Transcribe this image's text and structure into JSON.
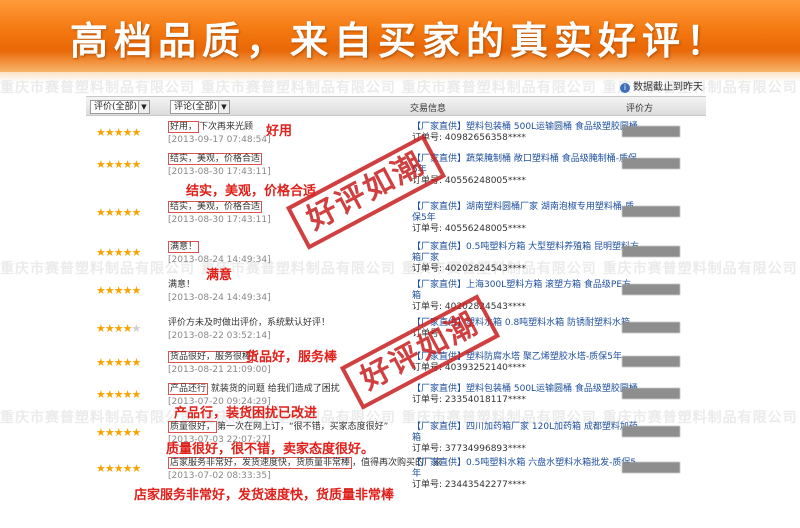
{
  "banner": {
    "text": "高档品质，来自买家的真实好评！"
  },
  "watermark": {
    "text": "重庆市赛普塑料制品有限公司 重庆市赛普塑料制品有限公司 重庆市赛普塑料制品有限公司 重庆市赛普塑料制品有限公司"
  },
  "updated": {
    "text": "数据截止到昨天"
  },
  "header": {
    "rating_select": "评价(全部)",
    "comment_select": "评论(全部)",
    "trade_label": "交易信息",
    "rater_label": "评价方"
  },
  "colors": {
    "accent": "#f47a12",
    "highlight": "#d9534f",
    "annotation": "#e0201a",
    "link": "#1d4f9c",
    "star": "#f6a400"
  },
  "stamps": [
    {
      "text": "好评如潮"
    },
    {
      "text": "好评如潮"
    }
  ],
  "reviews": [
    {
      "stars": "★★★★★",
      "dim": "",
      "comment": "好用，下次再来光顾",
      "hl": "好用，",
      "date": "[2013-09-17 07:48:54]",
      "annotation": "好用",
      "trade_title": "【厂家直供】塑料包装桶 500L运输圆桶 食品级塑胶圆桶",
      "order": "订单号: 40982656358****"
    },
    {
      "stars": "★★★★★",
      "dim": "",
      "comment": "结实，美观，价格合适",
      "hl": "结实，美观，价格合适",
      "date": "[2013-08-30 17:43:11]",
      "annotation": "结实，美观，价格合适",
      "trade_title": "【厂家直供】蔬菜腌制桶 敞口塑料桶 食品级腌制桶-质保5年",
      "order": "订单号: 40556248005****"
    },
    {
      "stars": "★★★★★",
      "dim": "",
      "comment": "结实，美观，价格合适",
      "hl": "结实，美观，价格合适",
      "date": "[2013-08-30 17:43:11]",
      "annotation": "",
      "trade_title": "【厂家直供】湖南塑料圆桶厂家 湖南泡椒专用塑料桶-质保5年",
      "order": "订单号: 40556248005****"
    },
    {
      "stars": "★★★★★",
      "dim": "",
      "comment": "满意！",
      "hl": "满意！",
      "date": "[2013-08-24 14:49:34]",
      "annotation": "满意",
      "trade_title": "【厂家直供】0.5吨塑料方箱 大型塑料养殖箱 昆明塑料方箱厂家",
      "order": "订单号: 40202824543****"
    },
    {
      "stars": "★★★★★",
      "dim": "",
      "comment": "满意！",
      "hl": "",
      "date": "[2013-08-24 14:49:34]",
      "annotation": "",
      "trade_title": "【厂家直供】上海300L塑料方箱 滚塑方箱 食品级PE方箱",
      "order": "订单号: 40202824543****"
    },
    {
      "stars": "★★★★",
      "dim": "★",
      "comment": "评价方未及时做出评价，系统默认好评！",
      "hl": "",
      "date": "[2013-08-22 03:52:14]",
      "annotation": "",
      "trade_title": "【厂家直供】塑料水箱 0.8吨塑料水箱 防锈耐塑料水箱",
      "order": "订单号:"
    },
    {
      "stars": "★★★★★",
      "dim": "",
      "comment": "货品很好，服务很棒",
      "hl": "货品很好，服务很棒",
      "date": "[2013-08-21 21:09:00]",
      "annotation": "货品好，服务棒",
      "trade_title": "【厂家直供】塑料防腐水塔 聚乙烯塑胶水塔-质保5年",
      "order": "订单号: 40393252140****"
    },
    {
      "stars": "★★★★★",
      "dim": "",
      "comment": "产品还行 就装货的问题 给我们造成了困扰",
      "hl": "产品还行",
      "date": "[2013-07-20 09:24:29]",
      "annotation": "产品行，装货困扰已改进",
      "trade_title": "【厂家直供】塑料包装桶 500L运输圆桶 食品级塑胶圆桶",
      "order": "订单号: 23354018117****"
    },
    {
      "stars": "★★★★★",
      "dim": "",
      "comment": "质量很好，第一次在网上订，“很不错，买家态度很好”",
      "hl": "质量很好，",
      "date": "[2013-07-03 22:07:27]",
      "annotation": "质量很好，很不错，卖家态度很好。",
      "trade_title": "【厂家直供】四川加药箱厂家 120L加药箱 成都塑料加药箱",
      "order": "订单号: 37734996893****"
    },
    {
      "stars": "★★★★★",
      "dim": "",
      "comment": "店家服务非常好，发货速度快，货质量非常棒，值得再次购买的厂家",
      "hl": "店家服务非常好，发货速度快，货质量非常棒",
      "date": "[2013-07-02 08:33:35]",
      "annotation": "店家服务非常好，发货速度快，货质量非常棒",
      "trade_title": "【厂家直供】0.5吨塑料水箱 六盘水塑料水箱批发-质保5年",
      "order": "订单号: 23443542277****"
    }
  ]
}
